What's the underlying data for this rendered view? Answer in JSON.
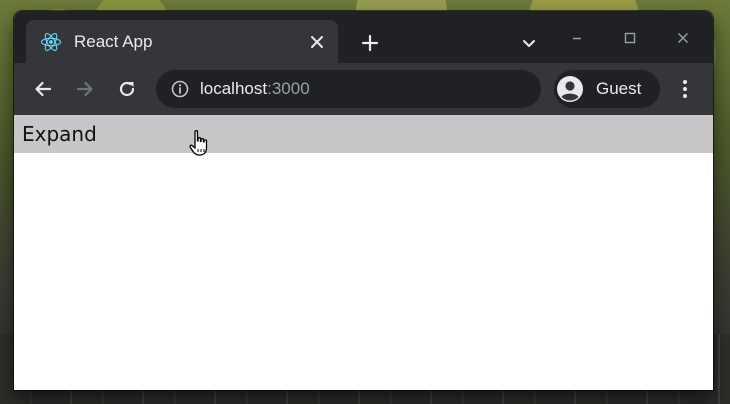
{
  "browser": {
    "tab": {
      "title": "React App",
      "favicon": "react-logo-icon"
    },
    "url": {
      "host": "localhost",
      "port": ":3000"
    },
    "profile": {
      "label": "Guest"
    },
    "colors": {
      "frame": "#202124",
      "toolbar": "#35363a",
      "text": "#e8eaed",
      "muted": "#9aa0a6"
    }
  },
  "page": {
    "expand_label": "Expand",
    "expand_bar_color": "#c8c6c8",
    "cursor": "hand-pointer-icon"
  }
}
